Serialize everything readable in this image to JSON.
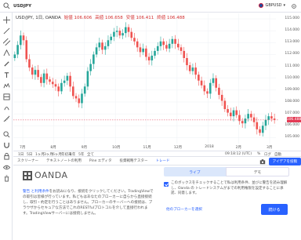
{
  "topbar": {
    "symbol": "USDJPY",
    "currency": "GBPUSD"
  },
  "legend": {
    "title": "USD/JPY, 1日, OANDA",
    "open": "始値 106.606",
    "high": "高値 106.658",
    "low": "安値 106.411",
    "close": "終値 106.488"
  },
  "price_axis": [
    "115.000",
    "114.000",
    "113.000",
    "112.000",
    "111.000",
    "110.000",
    "109.000",
    "108.000",
    "107.000",
    "106.000",
    "105.000"
  ],
  "current_price": "106.488",
  "time_axis": [
    "7月",
    "8月",
    "9月",
    "10月",
    "11月",
    "12月",
    "2018",
    "2月",
    "3月"
  ],
  "chart_bottom": {
    "left_labels": [
      "1日",
      "5日",
      "1ヶ月",
      "3ヶ月",
      "6ヶ月",
      "年初来",
      "1年",
      "5年",
      "全て"
    ],
    "time_display": "09:18:12 (UTC)",
    "percent": "%",
    "log": "ログ",
    "auto": "自動"
  },
  "tabs": {
    "items": [
      "スクリーナー",
      "テキストノートの利用",
      "Pine エディタ",
      "投資戦略テスター",
      "トレード"
    ],
    "active_index": 4,
    "open_account": "アイデアを投稿"
  },
  "panel": {
    "brand": "OANDA",
    "live_label": "ライブ",
    "demo_label": "デモ",
    "text_prefix": "警告",
    "text_link": "と利用条件",
    "text_body": "をお読みになり、接続をクリックしてください。TradingViewでの取引は皆様が行っています。私どもはあなたのブローカーに自らから直接接続し、取引・約定を行うことはありません。ブローカーのサーバーへの接続は、ブラウザからセキュアな方法でこれのRESTfulプロトコルを介して直接行われます。TradingViewサーバーには接続しません。",
    "check_text": "このボックスをチェックすることで私は利用条件、並びに警告を読み理解し、Oanda の トレードシステムがまでの利用権限を設定することに承諾、同意します。",
    "more_connections": "他のブローカーを選択",
    "continue_label": "続ける"
  },
  "chart_data": {
    "type": "candlestick",
    "ylim": [
      104.5,
      115.2
    ],
    "x": [
      "7月",
      "8月",
      "9月",
      "10月",
      "11月",
      "12月",
      "2018",
      "2月",
      "3月"
    ],
    "close": [
      112.0,
      112.8,
      113.6,
      113.2,
      111.6,
      110.9,
      110.3,
      110.7,
      110.1,
      109.6,
      110.4,
      109.9,
      109.7,
      109.5,
      109.3,
      108.9,
      109.6,
      109.8,
      110.2,
      109.3,
      108.5,
      108.3,
      107.9,
      108.7,
      109.3,
      110.6,
      111.2,
      112.0,
      112.6,
      113.0,
      112.4,
      112.7,
      113.2,
      113.5,
      113.9,
      114.0,
      113.6,
      113.8,
      114.3,
      113.9,
      113.4,
      113.1,
      112.6,
      112.2,
      112.5,
      111.8,
      111.5,
      111.9,
      112.3,
      112.7,
      113.1,
      112.8,
      112.5,
      112.9,
      113.3,
      112.9,
      112.6,
      112.3,
      111.7,
      111.1,
      110.6,
      110.9,
      110.3,
      109.8,
      109.4,
      108.9,
      108.7,
      109.6,
      110.0,
      109.2,
      108.6,
      108.1,
      107.4,
      107.1,
      106.8,
      107.3,
      106.9,
      106.4,
      106.2,
      106.6,
      107.0,
      106.7,
      106.3,
      105.7,
      105.4,
      106.0,
      106.5,
      106.8,
      106.6,
      106.488
    ]
  }
}
